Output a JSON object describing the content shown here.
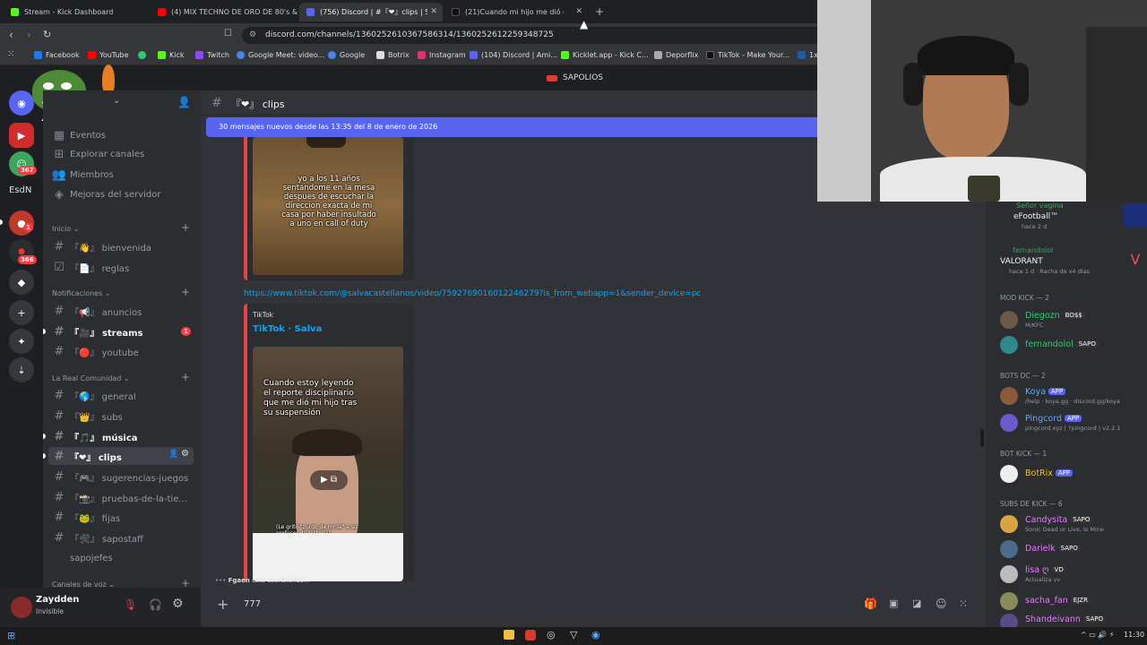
{
  "browser": {
    "tabs": [
      {
        "label": "Stream - Kick Dashboard",
        "color": "#53fc18"
      },
      {
        "label": "(4) MIX TECHNO DE ORO DE 80's &",
        "color": "#ff0000"
      },
      {
        "label": "(756) Discord | #『❤』clips | SAPOLIOS",
        "color": "#5865f2",
        "active": true
      },
      {
        "label": "(21)Cuando mi hijo me dió o",
        "color": "#111111"
      }
    ],
    "url": "discord.com/channels/1360252610367586314/1360252612259348725",
    "bookmarks": [
      "Facebook",
      "YouTube",
      "",
      "Kick",
      "Twitch",
      "Google Meet: video...",
      "Google",
      "Botrix",
      "Instagram",
      "(104) Discord | Ami...",
      "Kicklet.app - Kick C...",
      "Deporflix",
      "TikTok - Make Your...",
      "1x"
    ]
  },
  "discord": {
    "server_title": "SAPOLIOS",
    "servers": {
      "badges": [
        "367",
        "1",
        "366"
      ],
      "label": "EsdN",
      "overlay_text": "x4"
    },
    "sidebar": {
      "top_items": [
        "Eventos",
        "Explorar canales",
        "Miembros",
        "Mejoras del servidor"
      ],
      "categories": [
        {
          "name": "Inicio",
          "channels": [
            {
              "prefix": "『👋』",
              "name": "bienvenida"
            },
            {
              "prefix": "『📄』",
              "name": "reglas"
            }
          ]
        },
        {
          "name": "Notificaciones",
          "channels": [
            {
              "prefix": "『📢』",
              "name": "anuncios"
            },
            {
              "prefix": "『🎥』",
              "name": "streams",
              "unread": true,
              "badge": "1"
            },
            {
              "prefix": "『🔴』",
              "name": "youtube"
            }
          ]
        },
        {
          "name": "La Real Comunidad",
          "channels": [
            {
              "prefix": "『🌎』",
              "name": "general"
            },
            {
              "prefix": "『👑』",
              "name": "subs"
            },
            {
              "prefix": "『🎵』",
              "name": "música",
              "unread": true
            },
            {
              "prefix": "『❤』",
              "name": "clips",
              "selected": true
            },
            {
              "prefix": "『🎮』",
              "name": "sugerencias-juegos"
            },
            {
              "prefix": "『📸』",
              "name": "pruebas-de-la-tie..."
            },
            {
              "prefix": "『🐸』",
              "name": "fijas"
            },
            {
              "prefix": "『🛠』",
              "name": "sapostaff"
            },
            {
              "prefix": "",
              "name": "sapojefes"
            }
          ]
        }
      ],
      "voice_category": "Canales de voz"
    },
    "user": {
      "name": "Zaydden",
      "status": "Invisible"
    },
    "chat": {
      "channel": "『❤』 clips",
      "new_messages_bar": "30 mensajes nuevos desde las 13:35 del 8 de enero de 2026",
      "embed1_caption": "yo a los 11 años sentandome en la mesa despues de escuchar la direccion exacta de mi casa por haber insultado a uno en call of duty",
      "link": "https://www.tiktok.com/@salvacastellanos/video/7592769016012246279?is_from_webapp=1&sender_device=pc",
      "embed2_provider": "TikTok",
      "embed2_title": "TikTok · Salva",
      "embed2_caption": "Cuando estoy leyendo el reporte disciplinario que me dió mi hijo tras su suspensión",
      "embed2_subtitle": "(Le gritó \"zurdo de mrda\" a su profesor de historia)",
      "typing": "está escribiendo...",
      "typing_user": "Fgaen",
      "composer_value": "777"
    },
    "members": {
      "activity": [
        {
          "name": "Señor vagina",
          "game": "eFootball™",
          "time": "hace 2 d"
        },
        {
          "name": "fernandolol",
          "game": "VALORANT",
          "time": "hace 1 d",
          "streak": "Racha de x4 días"
        }
      ],
      "groups": [
        {
          "title": "MOD KICK — 2",
          "members": [
            {
              "name": "Diegozn",
              "tag": "BO$$",
              "sub": "M/KFC",
              "color": "#2ecc71"
            },
            {
              "name": "fernandolol",
              "tag": "SAPO",
              "sub": "",
              "color": "#2ecc71"
            }
          ]
        },
        {
          "title": "BOTS DC — 2",
          "members": [
            {
              "name": "Koya",
              "tag": "APP",
              "sub": "/help · koya.gg · discord.gg/koya",
              "color": "#5aa9ff"
            },
            {
              "name": "Pingcord",
              "tag": "APP",
              "sub": "pingcord.xyz | ?pingcord | v2.2.1",
              "color": "#5aa9ff"
            }
          ]
        },
        {
          "title": "BOT KICK — 1",
          "members": [
            {
              "name": "BotRix",
              "tag": "APP",
              "sub": "",
              "color": "#f1c40f"
            }
          ]
        },
        {
          "title": "SUBS DE KICK — 6",
          "members": [
            {
              "name": "Candysita",
              "tag": "SAPO",
              "sub": "Sonic Dead or Live, Is Mine",
              "color": "#e97bff"
            },
            {
              "name": "Darielk",
              "tag": "SAPO",
              "sub": "",
              "color": "#e97bff"
            },
            {
              "name": "lisa ღ",
              "tag": "VD",
              "sub": "Actualiza vv",
              "color": "#e97bff"
            },
            {
              "name": "sacha_fan",
              "tag": "EJZR",
              "sub": "",
              "color": "#e97bff"
            },
            {
              "name": "Shandeivann",
              "tag": "SAPO",
              "sub": "",
              "color": "#e97bff"
            }
          ]
        }
      ]
    }
  },
  "taskbar": {
    "time": "11:30"
  }
}
